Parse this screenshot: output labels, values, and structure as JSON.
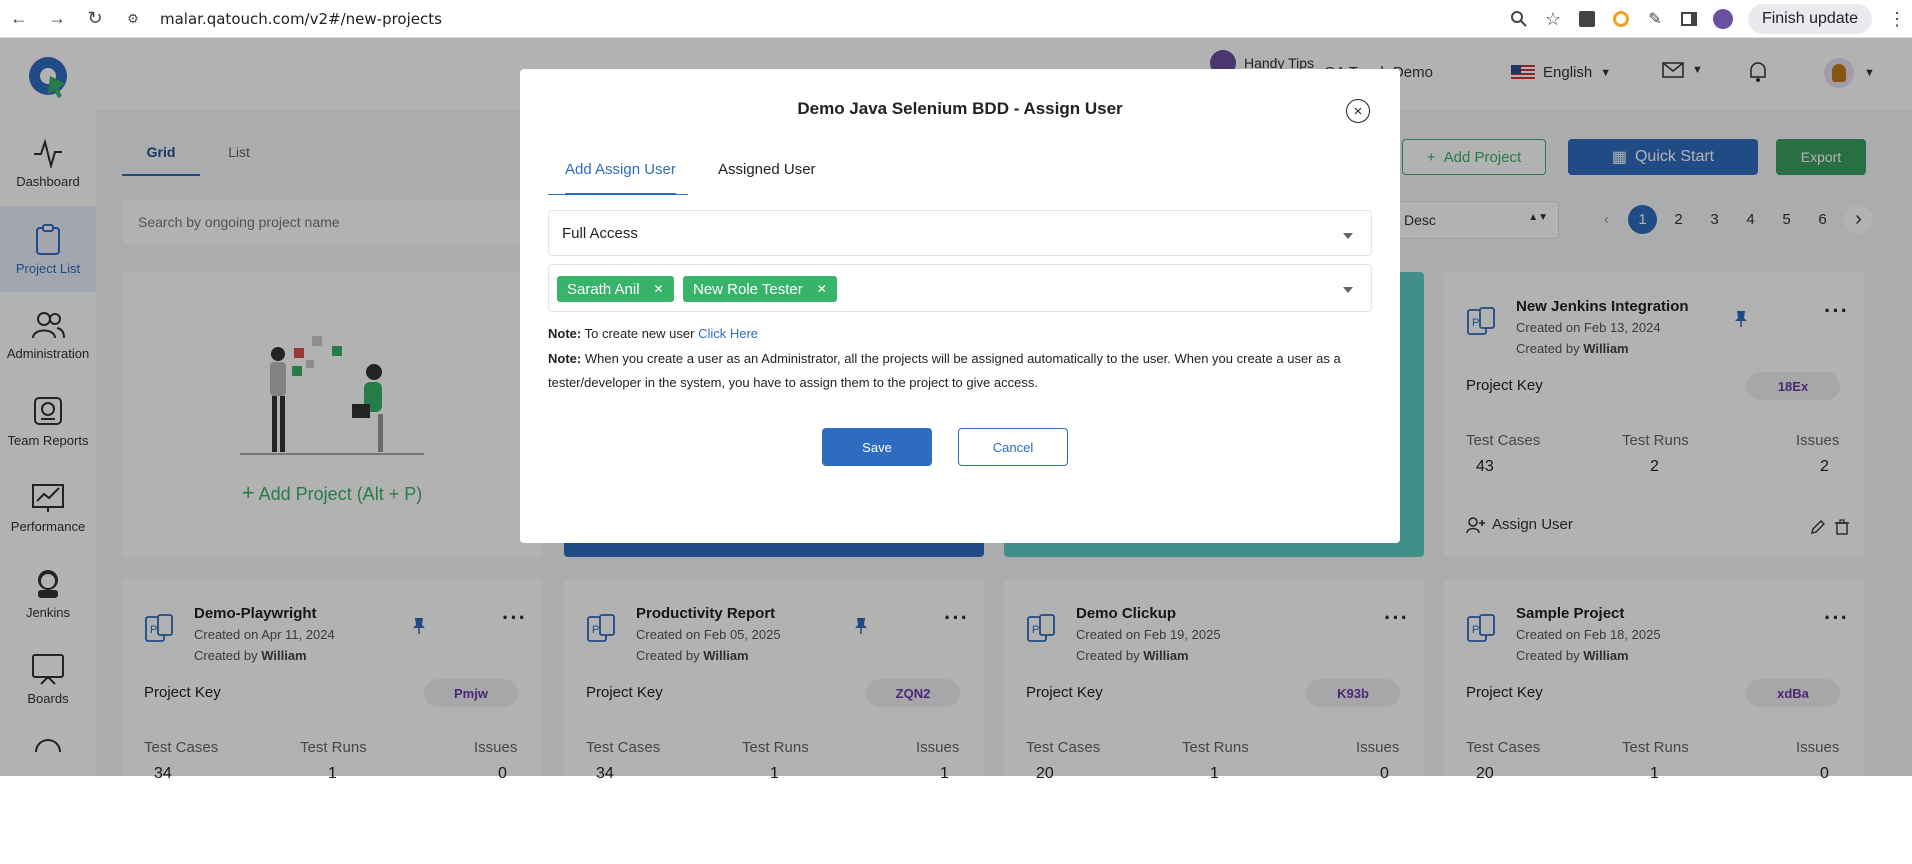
{
  "browser": {
    "url": "malar.qatouch.com/v2#/new-projects",
    "finish_update": "Finish update"
  },
  "sidebar": {
    "items": [
      {
        "label": "Dashboard",
        "icon": "pulse-icon"
      },
      {
        "label": "Project List",
        "icon": "clipboard-icon"
      },
      {
        "label": "Administration",
        "icon": "users-icon"
      },
      {
        "label": "Team Reports",
        "icon": "report-icon"
      },
      {
        "label": "Performance",
        "icon": "chart-icon"
      },
      {
        "label": "Jenkins",
        "icon": "jenkins-icon"
      },
      {
        "label": "Boards",
        "icon": "board-icon"
      }
    ]
  },
  "topbar": {
    "handy_tips": "Handy Tips",
    "workspace": "QA Touch Demo",
    "language": "English"
  },
  "toolbar": {
    "tab_grid": "Grid",
    "tab_list": "List",
    "search_placeholder": "Search by ongoing project name",
    "add_project": "Add Project",
    "quick_start": "Quick Start",
    "export": "Export",
    "sort": "Desc",
    "pages": [
      "1",
      "2",
      "3",
      "4",
      "5",
      "6"
    ]
  },
  "add_card": {
    "label": "Add Project (Alt + P)"
  },
  "cards": [
    {
      "title": "New Jenkins Integration",
      "created_on": "Created on Feb 13, 2024",
      "created_by_prefix": "Created by",
      "created_by": "William",
      "key_label": "Project Key",
      "key": "18Ex",
      "tc_label": "Test Cases",
      "tr_label": "Test Runs",
      "is_label": "Issues",
      "tc": "43",
      "tr": "2",
      "is": "2",
      "assign": "Assign User"
    },
    {
      "title": "Demo-Playwright",
      "created_on": "Created on Apr 11, 2024",
      "created_by_prefix": "Created by",
      "created_by": "William",
      "key_label": "Project Key",
      "key": "Pmjw",
      "tc_label": "Test Cases",
      "tr_label": "Test Runs",
      "is_label": "Issues",
      "tc": "34",
      "tr": "1",
      "is": "0"
    },
    {
      "title": "Productivity Report",
      "created_on": "Created on Feb 05, 2025",
      "created_by_prefix": "Created by",
      "created_by": "William",
      "key_label": "Project Key",
      "key": "ZQN2",
      "tc_label": "Test Cases",
      "tr_label": "Test Runs",
      "is_label": "Issues",
      "tc": "34",
      "tr": "1",
      "is": "1"
    },
    {
      "title": "Demo Clickup",
      "created_on": "Created on Feb 19, 2025",
      "created_by_prefix": "Created by",
      "created_by": "William",
      "key_label": "Project Key",
      "key": "K93b",
      "tc_label": "Test Cases",
      "tr_label": "Test Runs",
      "is_label": "Issues",
      "tc": "20",
      "tr": "1",
      "is": "0"
    },
    {
      "title": "Sample Project",
      "created_on": "Created on Feb 18, 2025",
      "created_by_prefix": "Created by",
      "created_by": "William",
      "key_label": "Project Key",
      "key": "xdBa",
      "tc_label": "Test Cases",
      "tr_label": "Test Runs",
      "is_label": "Issues",
      "tc": "20",
      "tr": "1",
      "is": "0"
    }
  ],
  "modal": {
    "title": "Demo Java Selenium BDD - Assign User",
    "tab_add": "Add Assign User",
    "tab_assigned": "Assigned User",
    "access": "Full Access",
    "chips": [
      "Sarath Anil",
      "New Role Tester"
    ],
    "note_label": "Note:",
    "note1": "To create new user",
    "note1_link": "Click Here",
    "note2": "When you create a user as an Administrator, all the projects will be assigned automatically to the user. When you create a user as a tester/developer in the system, you have to assign them to the project to give access.",
    "save": "Save",
    "cancel": "Cancel"
  },
  "colors": {
    "primary": "#2e6cbf",
    "green": "#37b36a",
    "export": "#3a9f62"
  }
}
